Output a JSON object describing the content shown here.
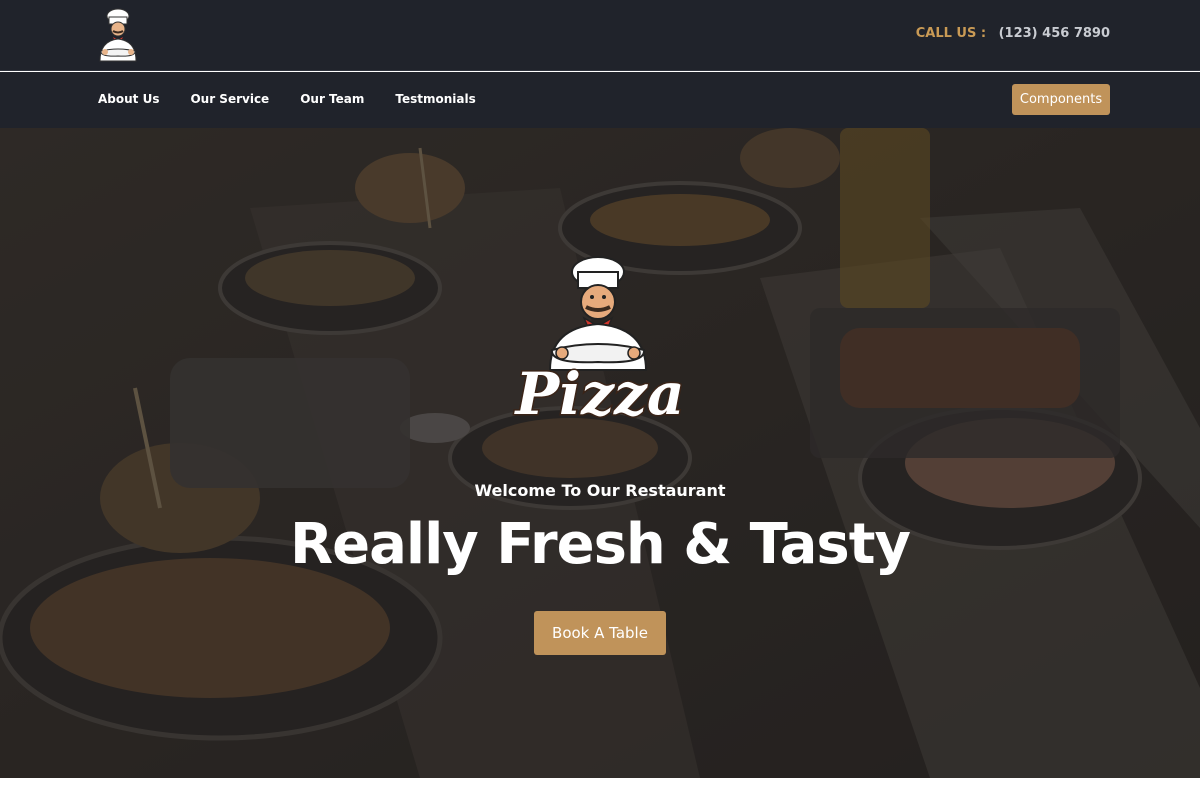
{
  "header": {
    "call_label": "CALL US :",
    "phone": "(123) 456 7890",
    "logo_icon": "chef-logo-icon"
  },
  "nav": {
    "items": [
      {
        "label": "About Us"
      },
      {
        "label": "Our Service"
      },
      {
        "label": "Our Team"
      },
      {
        "label": "Testmonials"
      }
    ],
    "components_label": "Components"
  },
  "hero": {
    "logo_text": "Pizza",
    "welcome": "Welcome To Our Restaurant",
    "headline": "Really Fresh & Tasty",
    "cta_label": "Book A Table",
    "background": "food-table-photo"
  },
  "colors": {
    "header_bg": "#20232b",
    "accent": "#c0935a",
    "call_label": "#c99a55",
    "hero_overlay": "#1c1a1b"
  }
}
